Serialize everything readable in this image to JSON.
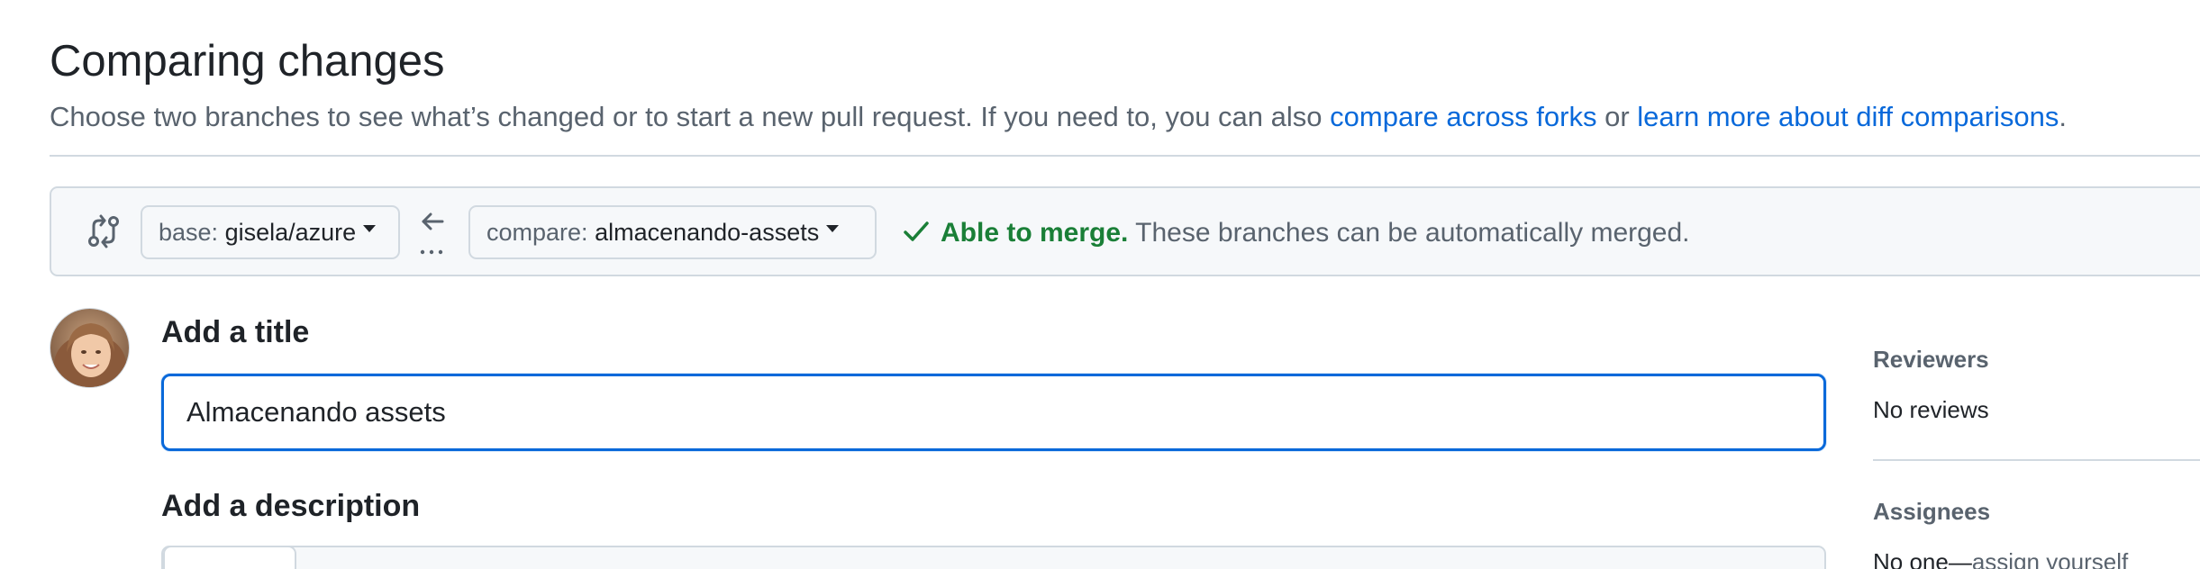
{
  "page": {
    "title": "Comparing changes",
    "subtitle_text": "Choose two branches to see what’s changed or to start a new pull request. If you need to, you can also ",
    "link_compare_forks": "compare across forks",
    "subtitle_or": " or ",
    "link_learn_more": "learn more about diff comparisons",
    "subtitle_end": "."
  },
  "compare_bar": {
    "base_prefix": "base: ",
    "base_branch": "gisela/azure",
    "compare_prefix": "compare: ",
    "compare_branch": "almacenando-assets",
    "merge_status_bold": "Able to merge.",
    "merge_status_text": " These branches can be automatically merged."
  },
  "form": {
    "title_label": "Add a title",
    "title_value": "Almacenando assets",
    "description_label": "Add a description"
  },
  "sidebar": {
    "reviewers_heading": "Reviewers",
    "reviewers_value": "No reviews",
    "assignees_heading": "Assignees",
    "assignees_prefix": "No one—",
    "assignees_link": "assign yourself"
  },
  "colors": {
    "accent": "#0969da",
    "success": "#1a7f37",
    "muted": "#59636e",
    "border": "#d1d9e0"
  },
  "icons": {
    "compare": "git-compare-icon",
    "arrow": "arrow-left-icon",
    "check": "check-icon",
    "avatar": "user-avatar"
  }
}
